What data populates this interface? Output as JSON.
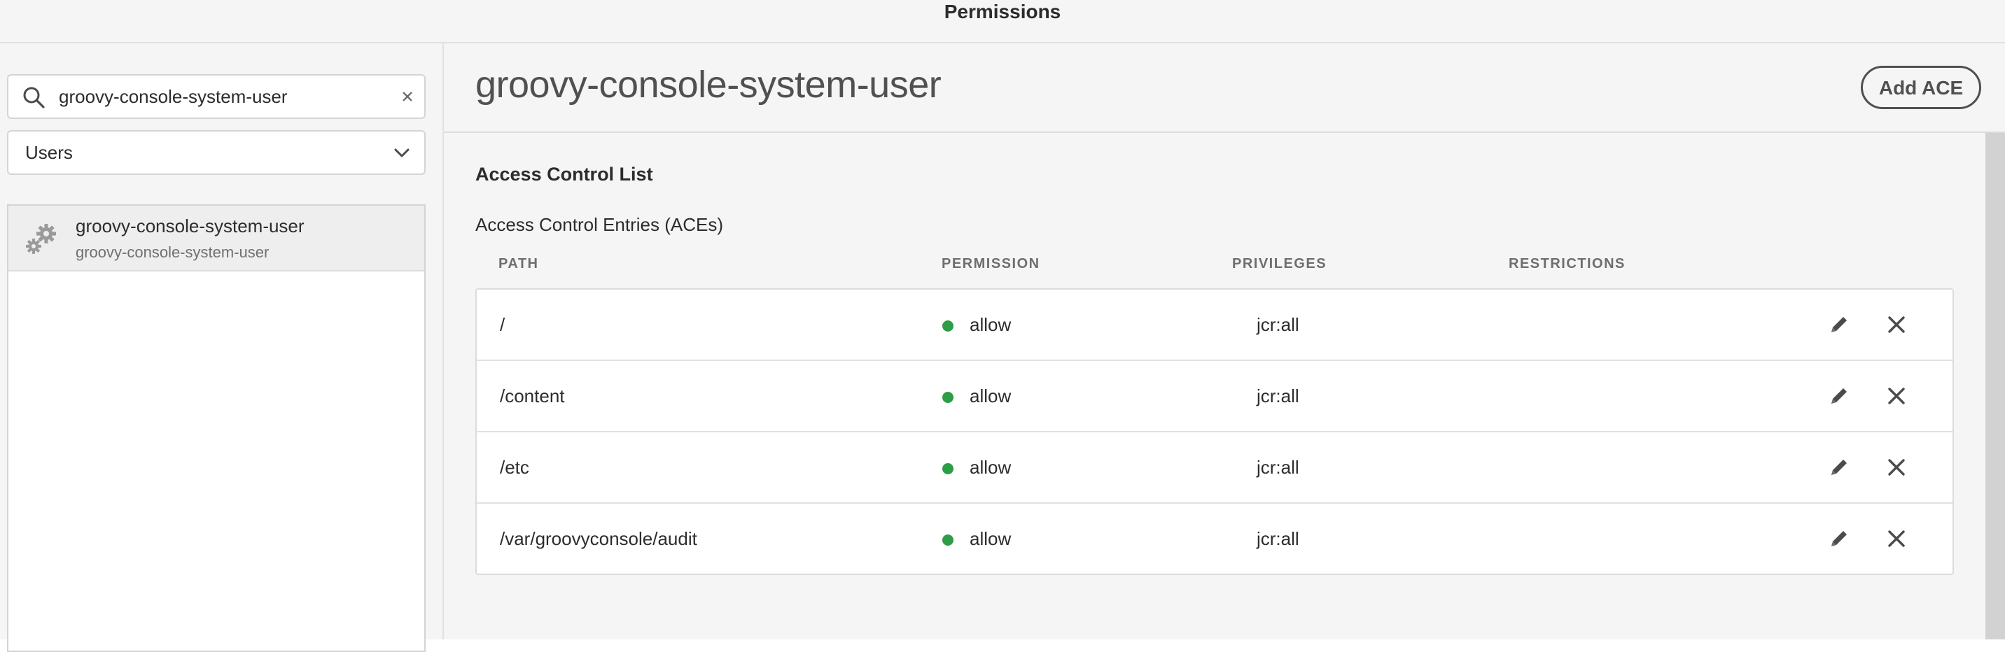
{
  "header": {
    "title": "Permissions"
  },
  "sidebar": {
    "search": {
      "value": "groovy-console-system-user",
      "icon": "search-icon",
      "clear_icon": "close-icon"
    },
    "type_select": {
      "selected": "Users",
      "icon": "chevron-down-icon"
    },
    "results": [
      {
        "name": "groovy-console-system-user",
        "subtitle": "groovy-console-system-user",
        "icon": "gear-icon"
      }
    ]
  },
  "main": {
    "title": "groovy-console-system-user",
    "add_button_label": "Add ACE",
    "acl_heading": "Access Control List",
    "aces_heading": "Access Control Entries (ACEs)",
    "columns": {
      "path": "PATH",
      "permission": "PERMISSION",
      "privileges": "PRIVILEGES",
      "restrictions": "RESTRICTIONS"
    },
    "rows": [
      {
        "path": "/",
        "permission": "allow",
        "privileges": "jcr:all",
        "restrictions": ""
      },
      {
        "path": "/content",
        "permission": "allow",
        "privileges": "jcr:all",
        "restrictions": ""
      },
      {
        "path": "/etc",
        "permission": "allow",
        "privileges": "jcr:all",
        "restrictions": ""
      },
      {
        "path": "/var/groovyconsole/audit",
        "permission": "allow",
        "privileges": "jcr:all",
        "restrictions": ""
      }
    ],
    "status_color": "#2d9d48",
    "row_icons": {
      "edit": "pencil-icon",
      "delete": "close-icon"
    }
  }
}
